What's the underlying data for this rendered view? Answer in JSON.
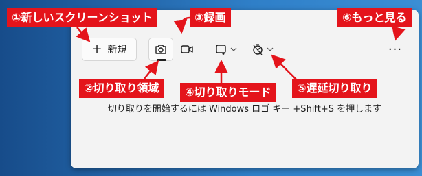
{
  "toolbar": {
    "new_label": "新規",
    "more_label": "···"
  },
  "hint": {
    "text": "切り取りを開始するには Windows ロゴ キー +Shift+S を押します"
  },
  "callouts": {
    "new_screenshot": "①新しいスクリーンショット",
    "snip_area": "②切り取り領域",
    "record": "③録画",
    "snip_mode": "④切り取りモード",
    "delay": "⑤遅延切り取り",
    "see_more": "⑥もっと見る"
  },
  "colors": {
    "callout_bg": "#e4141b",
    "window_bg": "#f3f3f3",
    "desktop_bg": "#1c5a9e"
  },
  "icons": [
    "plus-icon",
    "camera-icon",
    "video-icon",
    "snip-mode-icon",
    "timer-icon",
    "chevron-down-icon",
    "more-icon"
  ]
}
